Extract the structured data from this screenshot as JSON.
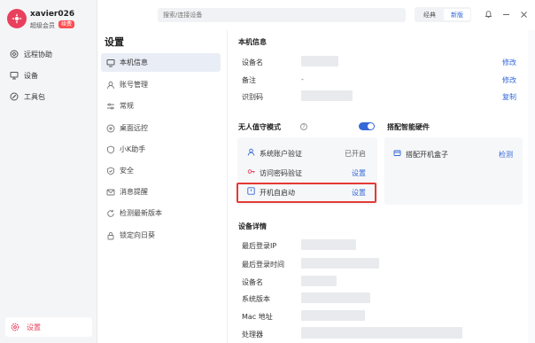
{
  "user": {
    "name": "xavier026",
    "level": "超级会员",
    "badge": "续费"
  },
  "sidebar": {
    "items": [
      {
        "label": "远程协助",
        "icon": "remote-assist-icon"
      },
      {
        "label": "设备",
        "icon": "monitor-icon"
      },
      {
        "label": "工具包",
        "icon": "toolbox-icon"
      }
    ],
    "bottom": {
      "label": "设置",
      "icon": "gear-icon"
    }
  },
  "topbar": {
    "search_placeholder": "搜索/连接设备",
    "view_classic": "经典",
    "view_new": "新版"
  },
  "settings": {
    "title": "设置",
    "items": [
      {
        "label": "本机信息",
        "icon": "computer-icon",
        "active": true
      },
      {
        "label": "账号管理",
        "icon": "user-icon"
      },
      {
        "label": "常规",
        "icon": "sliders-icon"
      },
      {
        "label": "桌面远控",
        "icon": "desktop-icon"
      },
      {
        "label": "小K助手",
        "icon": "assistant-icon"
      },
      {
        "label": "安全",
        "icon": "shield-icon"
      },
      {
        "label": "消息提醒",
        "icon": "message-icon"
      },
      {
        "label": "检测最新版本",
        "icon": "refresh-icon"
      },
      {
        "label": "锁定向日葵",
        "icon": "lock-icon"
      }
    ]
  },
  "local_info": {
    "title": "本机信息",
    "rows": [
      {
        "label": "设备名",
        "action": "修改"
      },
      {
        "label": "备注",
        "value": "-",
        "action": "修改"
      },
      {
        "label": "识别码",
        "action": "复制"
      }
    ]
  },
  "unattended": {
    "title": "无人值守模式",
    "enabled": true,
    "rows": [
      {
        "label": "系统账户验证",
        "status": "已开启",
        "icon": "user-check-icon"
      },
      {
        "label": "访问密码验证",
        "action": "设置",
        "icon": "key-icon"
      },
      {
        "label": "开机自启动",
        "action": "设置",
        "icon": "power-icon"
      }
    ]
  },
  "hardware": {
    "title": "搭配智能硬件",
    "rows": [
      {
        "label": "搭配开机盒子",
        "action": "检测",
        "icon": "box-icon"
      }
    ]
  },
  "device_details": {
    "title": "设备详情",
    "rows": [
      {
        "label": "最后登录IP"
      },
      {
        "label": "最后登录时间"
      },
      {
        "label": "设备名"
      },
      {
        "label": "系统版本"
      },
      {
        "label": "Mac 地址"
      },
      {
        "label": "处理器"
      }
    ]
  },
  "colors": {
    "accent": "#3468d8",
    "brand": "#e8405d",
    "highlight_box": "#e53935"
  }
}
